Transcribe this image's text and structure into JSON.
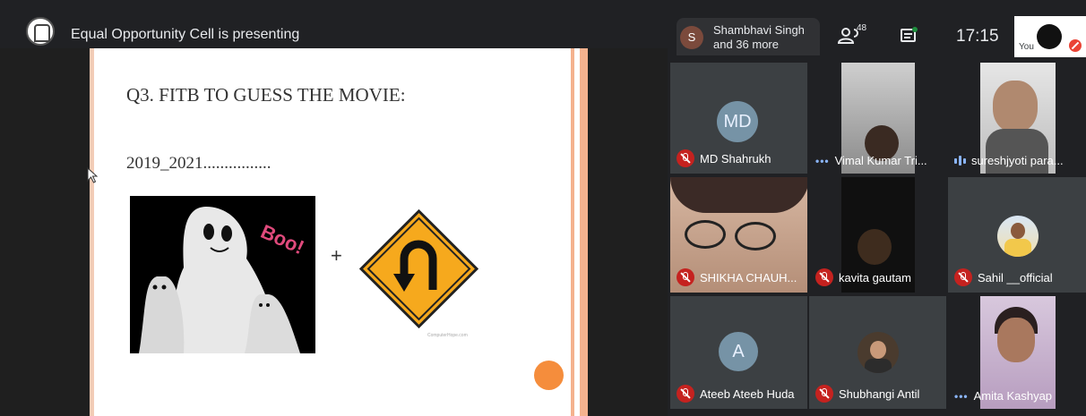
{
  "header": {
    "presenting_title": "Equal Opportunity Cell is presenting",
    "others_avatar_letter": "S",
    "others_line1": "Shambhavi Singh",
    "others_line2": "and 36 more",
    "people_count": "48",
    "clock": "17:15",
    "you_label": "You",
    "icons": [
      "people-icon",
      "chat-icon",
      "mic-off-icon"
    ]
  },
  "slide": {
    "question": "Q3. FITB TO GUESS THE MOVIE:",
    "hint": "2019_2021................",
    "boo_text": "Boo!",
    "plus": "+",
    "credit": "ComputerHope.com",
    "colors": {
      "border": "#f4b28e",
      "dot": "#f58d3c"
    }
  },
  "participants": [
    {
      "name": "MD Shahrukh",
      "status": "muted",
      "avatar": "MD"
    },
    {
      "name": "Vimal Kumar Tri...",
      "status": "more"
    },
    {
      "name": "sureshjyoti para...",
      "status": "speaking"
    },
    {
      "name": "SHIKHA CHAUH...",
      "status": "muted"
    },
    {
      "name": "kavita gautam",
      "status": "muted"
    },
    {
      "name": "Sahil __official",
      "status": "muted"
    },
    {
      "name": "Ateeb Ateeb Huda",
      "status": "muted",
      "avatar": "A"
    },
    {
      "name": "Shubhangi Antil",
      "status": "muted"
    },
    {
      "name": "Amita Kashyap",
      "status": "more"
    }
  ]
}
